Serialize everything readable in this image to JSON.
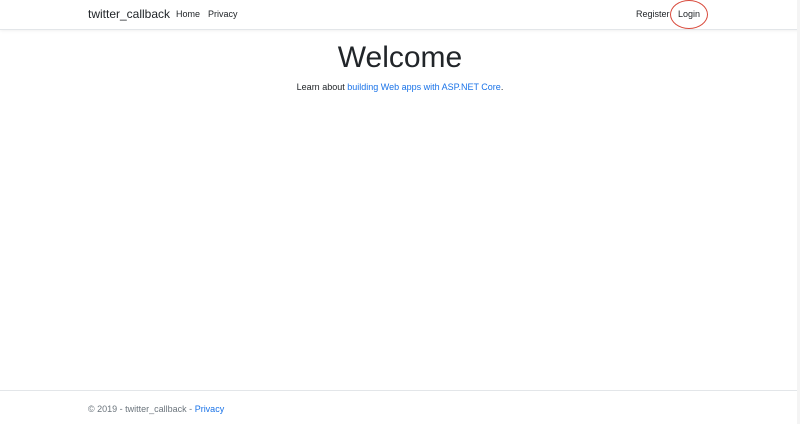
{
  "header": {
    "brand": "twitter_callback",
    "nav_left": [
      {
        "label": "Home"
      },
      {
        "label": "Privacy"
      }
    ],
    "nav_right": [
      {
        "label": "Register"
      },
      {
        "label": "Login"
      }
    ],
    "highlight_color": "#d94a3c"
  },
  "main": {
    "title": "Welcome",
    "lead_prefix": "Learn about ",
    "lead_link": "building Web apps with ASP.NET Core",
    "lead_suffix": "."
  },
  "footer": {
    "copyright": "© 2019 - twitter_callback - ",
    "privacy_link": "Privacy"
  },
  "colors": {
    "link": "#1a73e8",
    "text": "#212529",
    "border": "#e3e6e9"
  }
}
